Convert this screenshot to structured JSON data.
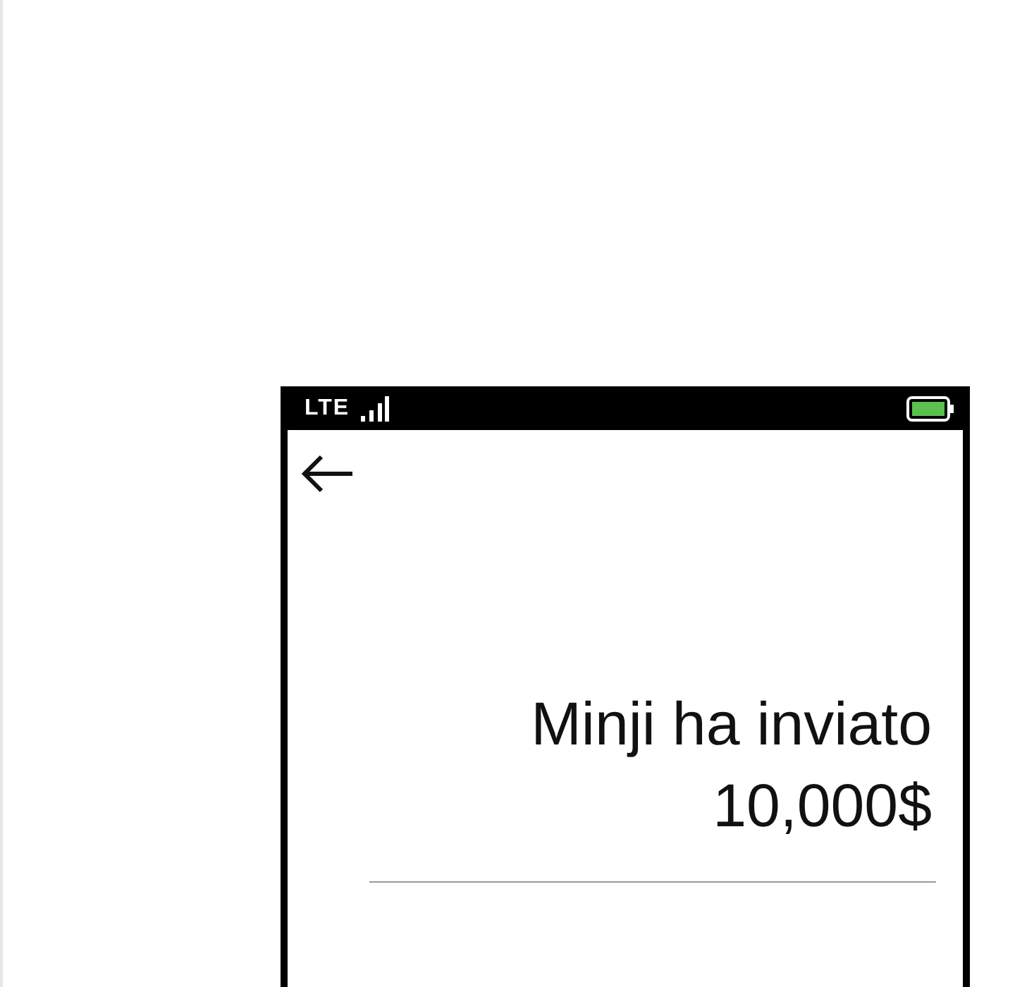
{
  "status_bar": {
    "network": "LTE"
  },
  "message": {
    "text": "Minji ha inviato 10,000$"
  }
}
